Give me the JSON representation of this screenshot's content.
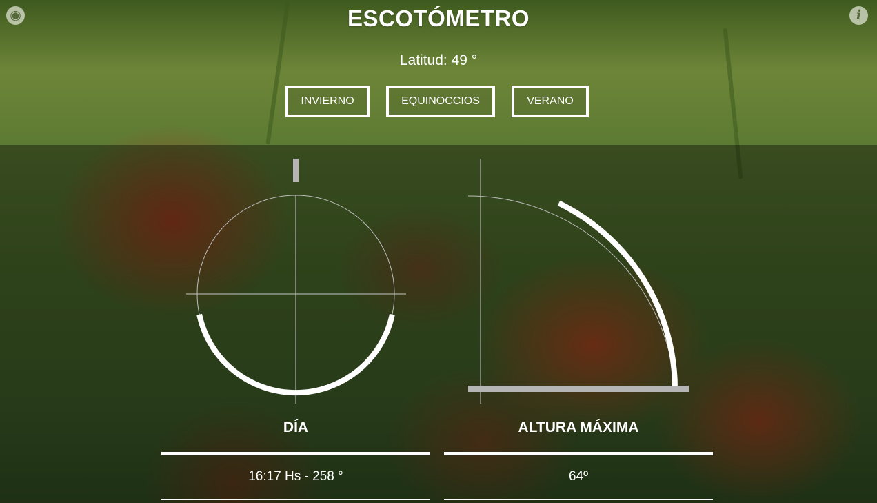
{
  "app": {
    "title": "ESCOTÓMETRO",
    "github_icon": "github-icon",
    "info_icon": "info-icon"
  },
  "latitude": {
    "label": "Latitud: 49 °",
    "value": 49,
    "unit": "°"
  },
  "seasons": {
    "winter_label": "INVIERNO",
    "equinox_label": "EQUINOCCIOS",
    "summer_label": "VERANO"
  },
  "day_panel": {
    "title": "DÍA",
    "value": "16:17 Hs - 258 °",
    "azimuth_deg": 258
  },
  "altitude_panel": {
    "title": "ALTURA MÁXIMA",
    "value": "64º",
    "max_altitude_deg": 64
  },
  "colors": {
    "foreground": "#ffffff",
    "muted": "#b5b5b5",
    "guide": "#c8c8c8"
  }
}
